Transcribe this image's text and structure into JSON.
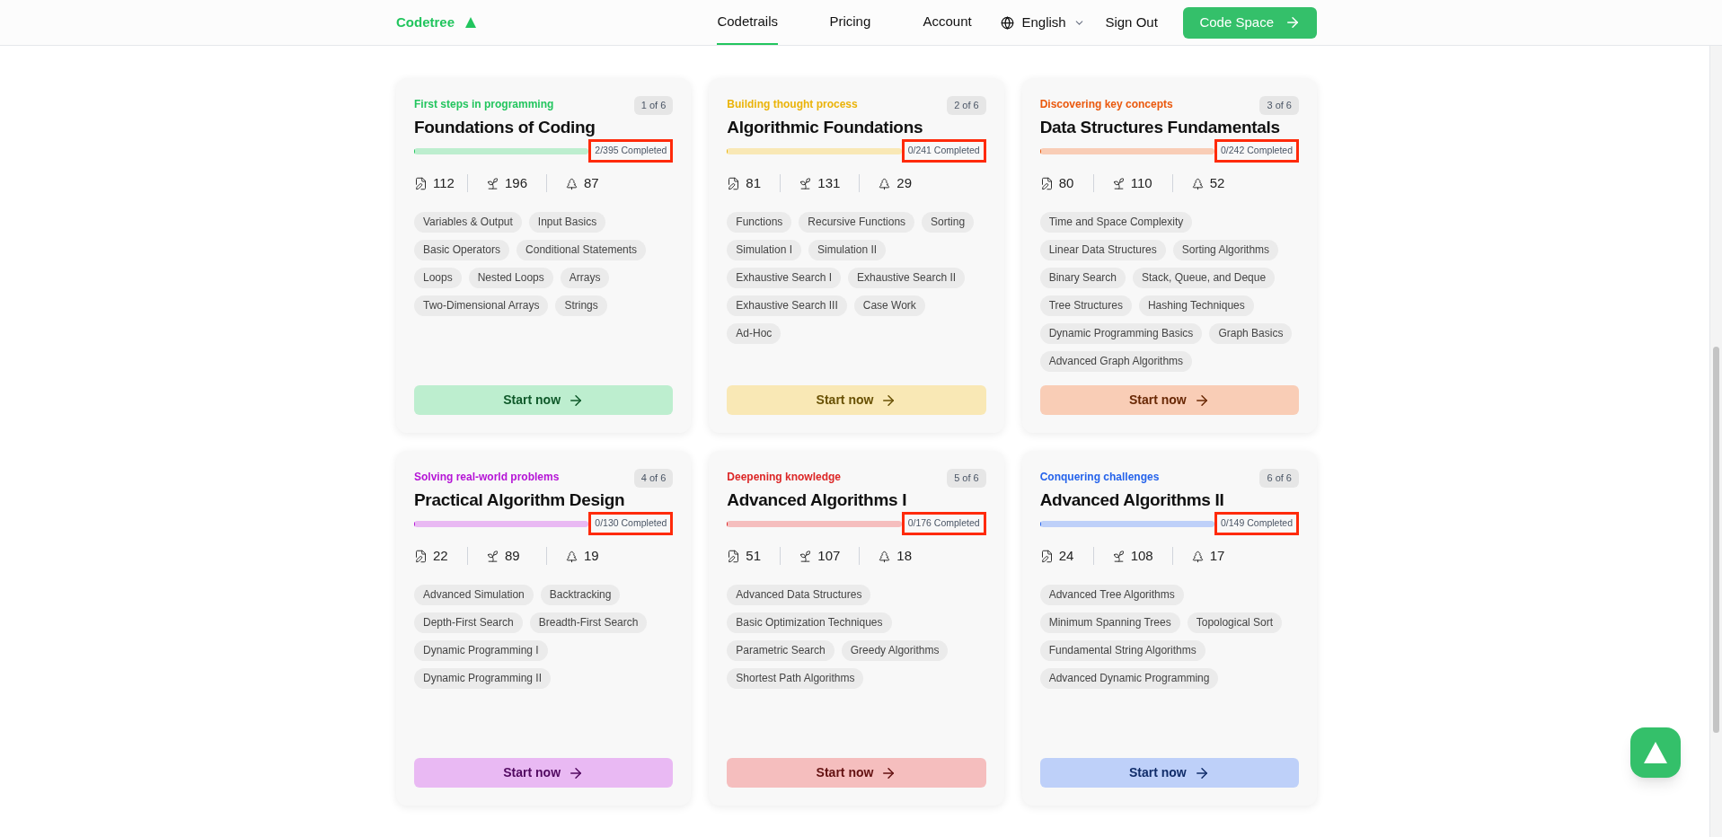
{
  "header": {
    "logo": "Codetree",
    "nav": [
      {
        "label": "Codetrails",
        "selected": true
      },
      {
        "label": "Pricing",
        "selected": false
      },
      {
        "label": "Account",
        "selected": false
      }
    ],
    "language": "English",
    "sign_out": "Sign Out",
    "cta": "Code Space"
  },
  "cards": [
    {
      "category": "First steps in programming",
      "color": "#22c55e",
      "step": "1 of 6",
      "title": "Foundations of Coding",
      "level": 0.005,
      "completed": "2/395 Completed",
      "stats": [
        "112",
        "196",
        "87"
      ],
      "tags": [
        "Variables & Output",
        "Input Basics",
        "Basic Operators",
        "Conditional Statements",
        "Loops",
        "Nested Loops",
        "Arrays",
        "Two-Dimensional Arrays",
        "Strings"
      ],
      "button": "Start now"
    },
    {
      "category": "Building thought process",
      "color": "#eab308",
      "step": "2 of 6",
      "title": "Algorithmic Foundations",
      "level": 0,
      "completed": "0/241 Completed",
      "stats": [
        "81",
        "131",
        "29"
      ],
      "tags": [
        "Functions",
        "Recursive Functions",
        "Sorting",
        "Simulation I",
        "Simulation II",
        "Exhaustive Search I",
        "Exhaustive Search II",
        "Exhaustive Search III",
        "Case Work",
        "Ad-Hoc"
      ],
      "button": "Start now"
    },
    {
      "category": "Discovering key concepts",
      "color": "#ea580c",
      "step": "3 of 6",
      "title": "Data Structures Fundamentals",
      "level": 0,
      "completed": "0/242 Completed",
      "stats": [
        "80",
        "110",
        "52"
      ],
      "tags": [
        "Time and Space Complexity",
        "Linear Data Structures",
        "Sorting Algorithms",
        "Binary Search",
        "Stack, Queue, and Deque",
        "Tree Structures",
        "Hashing Techniques",
        "Dynamic Programming Basics",
        "Graph Basics",
        "Advanced Graph Algorithms"
      ],
      "button": "Start now"
    },
    {
      "category": "Solving real-world problems",
      "color": "#b514d6",
      "step": "4 of 6",
      "title": "Practical Algorithm Design",
      "level": 0,
      "completed": "0/130 Completed",
      "stats": [
        "22",
        "89",
        "19"
      ],
      "tags": [
        "Advanced Simulation",
        "Backtracking",
        "Depth-First Search",
        "Breadth-First Search",
        "Dynamic Programming I",
        "Dynamic Programming II"
      ],
      "button": "Start now"
    },
    {
      "category": "Deepening knowledge",
      "color": "#dc2626",
      "step": "5 of 6",
      "title": "Advanced Algorithms I",
      "level": 0,
      "completed": "0/176 Completed",
      "stats": [
        "51",
        "107",
        "18"
      ],
      "tags": [
        "Advanced Data Structures",
        "Basic Optimization Techniques",
        "Parametric Search",
        "Greedy Algorithms",
        "Shortest Path Algorithms"
      ],
      "button": "Start now"
    },
    {
      "category": "Conquering challenges",
      "color": "#2563eb",
      "step": "6 of 6",
      "title": "Advanced Algorithms II",
      "level": 0,
      "completed": "0/149 Completed",
      "stats": [
        "24",
        "108",
        "17"
      ],
      "tags": [
        "Advanced Tree Algorithms",
        "Minimum Spanning Trees",
        "Topological Sort",
        "Fundamental String Algorithms",
        "Advanced Dynamic Programming"
      ],
      "button": "Start now"
    }
  ]
}
